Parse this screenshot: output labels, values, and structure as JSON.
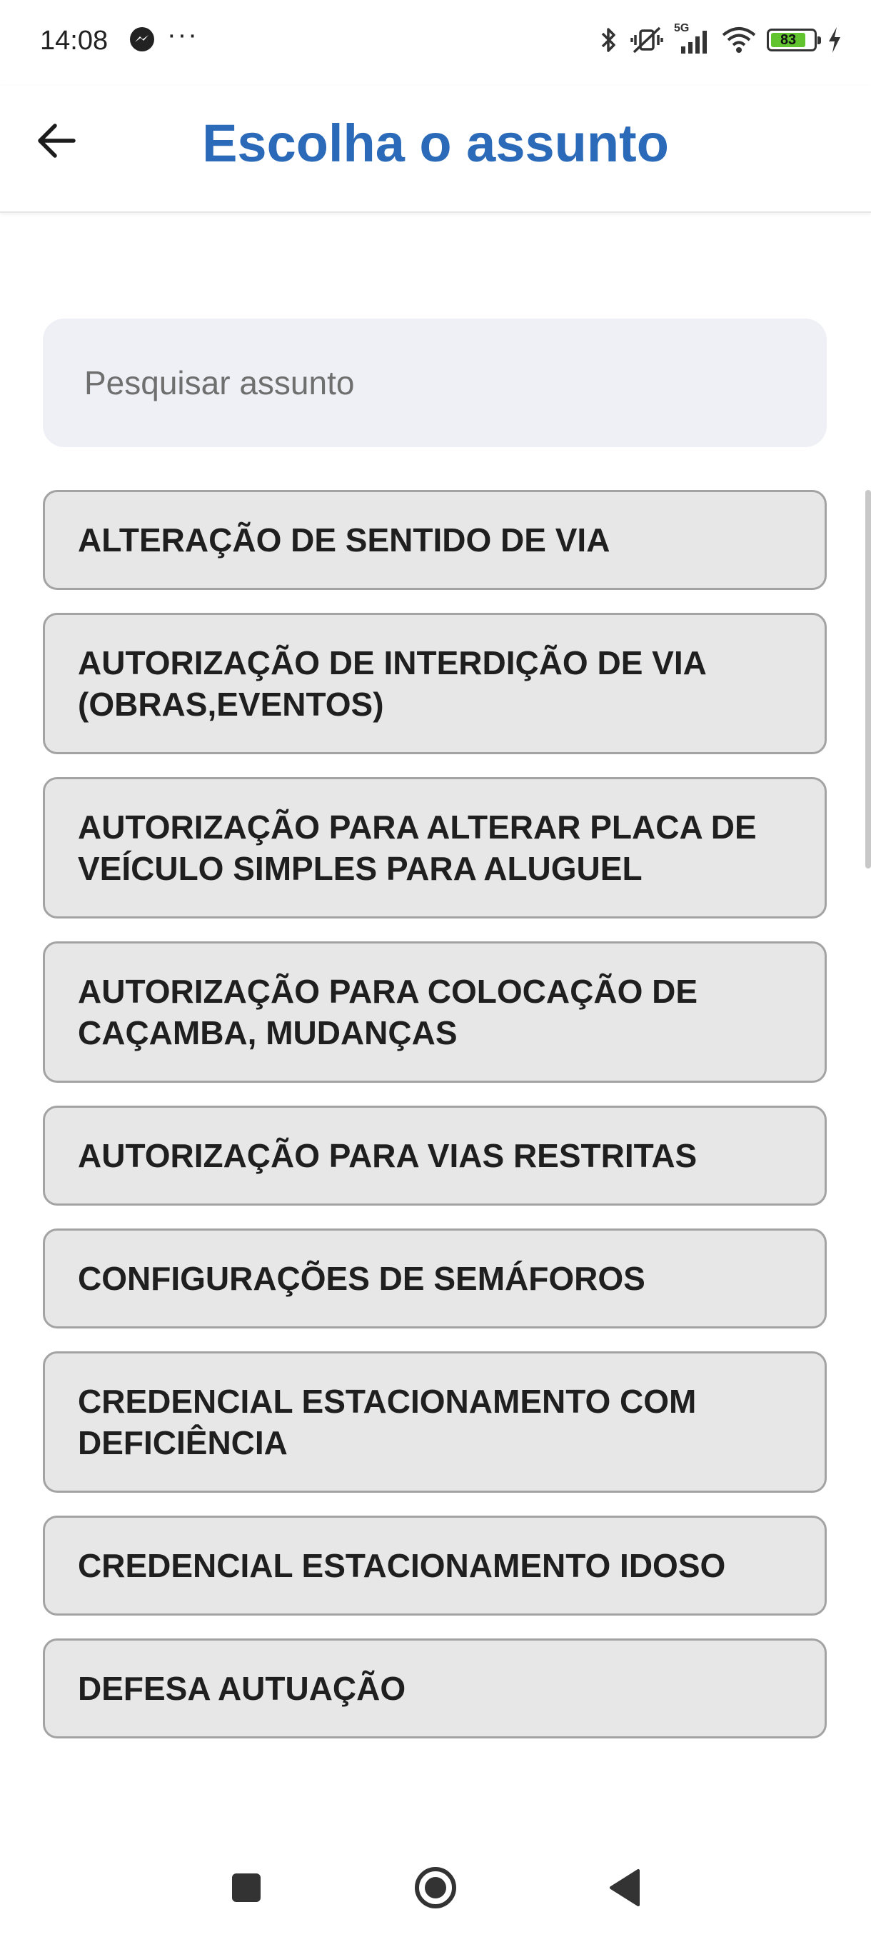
{
  "status_bar": {
    "time": "14:08",
    "more": "···",
    "battery_level": "83",
    "network": "5G"
  },
  "header": {
    "title": "Escolha o assunto"
  },
  "search": {
    "placeholder": "Pesquisar assunto",
    "value": ""
  },
  "subjects": [
    "ALTERAÇÃO DE SENTIDO DE VIA",
    "AUTORIZAÇÃO DE INTERDIÇÃO DE VIA (OBRAS,EVENTOS)",
    "AUTORIZAÇÃO PARA ALTERAR PLACA DE VEÍCULO SIMPLES PARA ALUGUEL",
    "AUTORIZAÇÃO PARA COLOCAÇÃO DE CAÇAMBA, MUDANÇAS",
    "AUTORIZAÇÃO PARA VIAS RESTRITAS",
    "CONFIGURAÇÕES DE SEMÁFOROS",
    "CREDENCIAL ESTACIONAMENTO COM DEFICIÊNCIA",
    "CREDENCIAL ESTACIONAMENTO IDOSO",
    "DEFESA AUTUAÇÃO"
  ],
  "colors": {
    "title": "#2a6ab8",
    "item_bg": "#e7e7e7",
    "item_border": "#a3a3a3",
    "search_bg": "#eef0f6"
  },
  "icons": {
    "back": "arrow-left-icon",
    "nav_recents": "square-icon",
    "nav_home": "circle-icon",
    "nav_back": "triangle-left-icon"
  }
}
